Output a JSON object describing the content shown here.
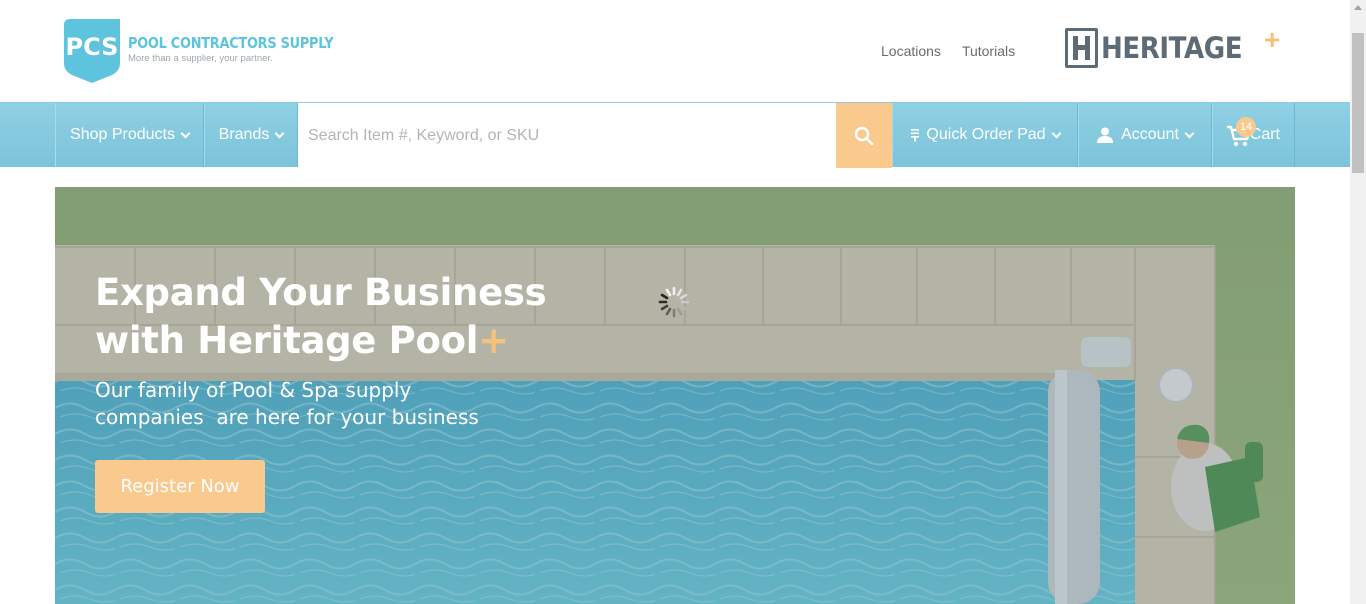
{
  "header": {
    "logo": {
      "abbr": "PCS",
      "name": "POOL CONTRACTORS SUPPLY",
      "tagline": "More than a supplier, your partner.",
      "color": "#5ec3dd"
    },
    "links": [
      "Locations",
      "Tutorials"
    ],
    "partner_logo": {
      "text": "HERITAGE",
      "plus": "+",
      "color": "#5d6b76",
      "accent": "#f9c07b"
    }
  },
  "nav": {
    "shop_products": "Shop Products",
    "brands": "Brands",
    "search_placeholder": "Search Item #, Keyword, or SKU",
    "search_icon": "search-icon",
    "quick_order": "Quick Order Pad",
    "account": "Account",
    "cart": "Cart",
    "cart_count": "14",
    "bar_color": "#84c8dd",
    "accent_color": "#f9c98d"
  },
  "hero": {
    "title_line1": "Expand Your Business",
    "title_line2": "with Heritage Pool",
    "title_plus": "+",
    "subtitle_line1": "Our family of Pool & Spa supply",
    "subtitle_line2": "companies  are here for your business",
    "cta": "Register Now",
    "loading": true
  }
}
